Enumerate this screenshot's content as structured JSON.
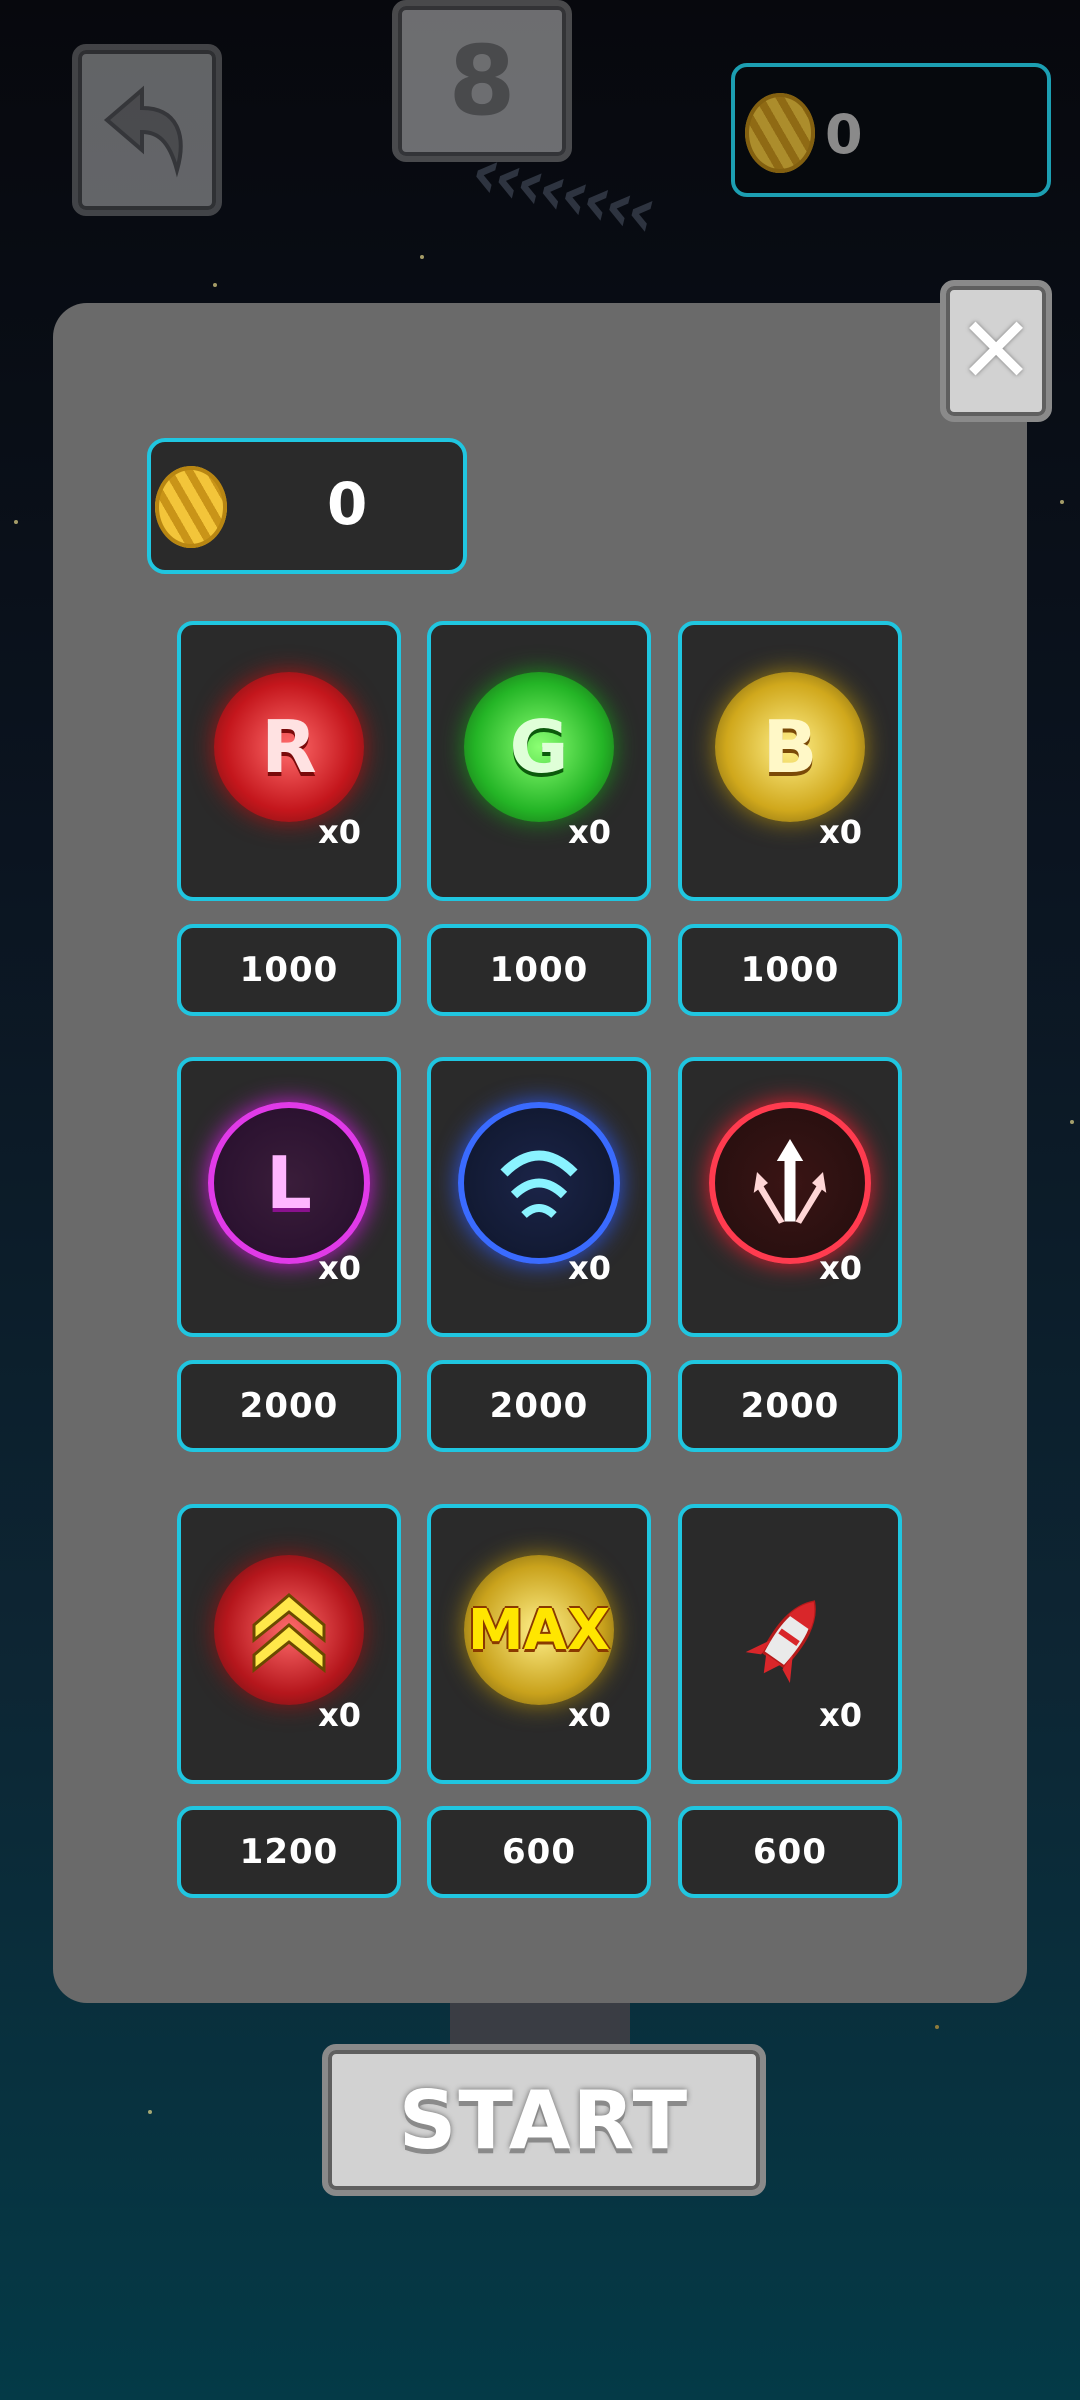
{
  "hud": {
    "level": "8",
    "coins": "0"
  },
  "shop": {
    "coins": "0",
    "items": [
      {
        "icon": "r-powerup-icon",
        "letter": "R",
        "count": "x0",
        "price": "1000"
      },
      {
        "icon": "g-powerup-icon",
        "letter": "G",
        "count": "x0",
        "price": "1000"
      },
      {
        "icon": "b-powerup-icon",
        "letter": "B",
        "count": "x0",
        "price": "1000"
      },
      {
        "icon": "l-powerup-icon",
        "letter": "L",
        "count": "x0",
        "price": "2000"
      },
      {
        "icon": "wave-powerup-icon",
        "letter": "",
        "count": "x0",
        "price": "2000"
      },
      {
        "icon": "spread-arrows-powerup-icon",
        "letter": "",
        "count": "x0",
        "price": "2000"
      },
      {
        "icon": "speed-up-powerup-icon",
        "letter": "",
        "count": "x0",
        "price": "1200"
      },
      {
        "icon": "max-powerup-icon",
        "letter": "MAX",
        "count": "x0",
        "price": "600"
      },
      {
        "icon": "rocket-icon",
        "letter": "",
        "count": "x0",
        "price": "600"
      }
    ]
  },
  "start_label": "START",
  "colors": {
    "accent": "#20c6e0",
    "panel": "#6a6a6a",
    "tile": "#2a2a2a"
  }
}
